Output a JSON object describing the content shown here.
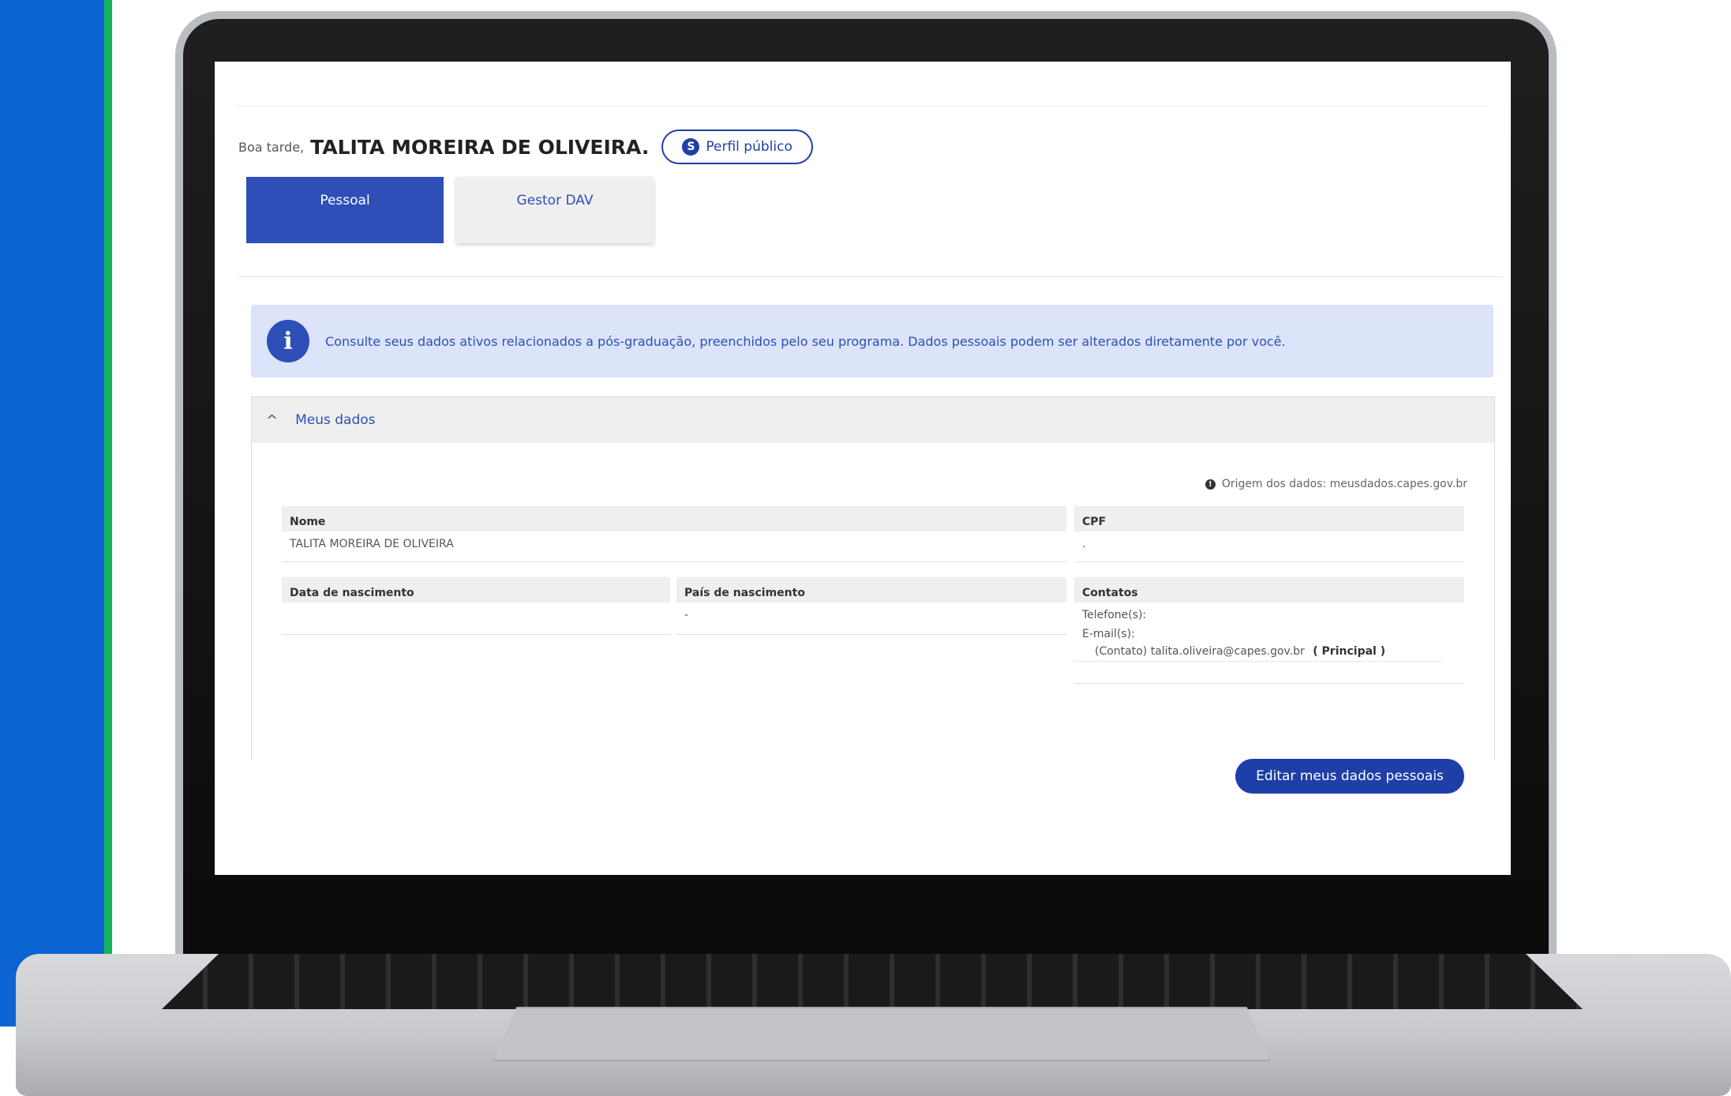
{
  "greeting": {
    "label": "Boa tarde,",
    "name": "TALITA MOREIRA DE OLIVEIRA.",
    "public_profile_button": "Perfil público",
    "public_profile_icon": "S"
  },
  "tabs": [
    {
      "label": "Pessoal",
      "active": true
    },
    {
      "label": "Gestor DAV",
      "active": false
    }
  ],
  "info_banner": {
    "icon": "i",
    "text": "Consulte seus dados ativos relacionados a pós-graduação, preenchidos pelo seu programa. Dados pessoais podem ser alterados diretamente por você."
  },
  "meus_dados": {
    "title": "Meus dados",
    "chevron": "^",
    "origem_icon": "!",
    "origem": "Origem dos dados: meusdados.capes.gov.br",
    "fields": {
      "nome": {
        "label": "Nome",
        "value": "TALITA MOREIRA DE OLIVEIRA"
      },
      "cpf": {
        "label": "CPF",
        "value": "."
      },
      "data_nascimento": {
        "label": "Data de nascimento",
        "value": ""
      },
      "pais_nascimento": {
        "label": "País de nascimento",
        "value": "-"
      },
      "contatos": {
        "label": "Contatos",
        "telefones_label": "Telefone(s):",
        "emails_label": "E-mail(s):",
        "email": "(Contato) talita.oliveira@capes.gov.br",
        "email_tag": "( Principal )"
      }
    },
    "edit_button": "Editar meus dados pessoais"
  },
  "colors": {
    "primary": "#2e4fb8",
    "accent_band": "#0b64d2",
    "accent_green": "#19b35c",
    "banner_bg": "#dbe4f8"
  }
}
